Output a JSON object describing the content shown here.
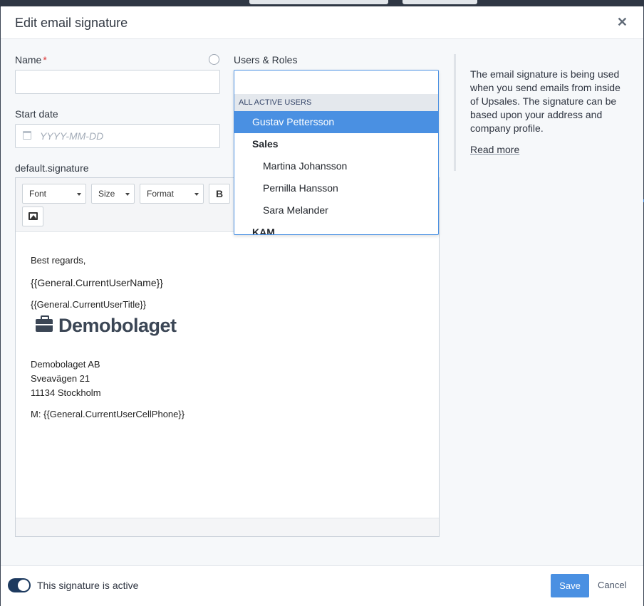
{
  "modal": {
    "title": "Edit email signature",
    "close_icon": "close-icon"
  },
  "form": {
    "name_label": "Name",
    "name_required_marker": "*",
    "name_value": "",
    "start_date_label": "Start date",
    "start_date_placeholder": "YYYY-MM-DD",
    "signature_label": "default.signature",
    "users_roles_label": "Users & Roles"
  },
  "toolbar": {
    "font_label": "Font",
    "size_label": "Size",
    "format_label": "Format",
    "bold_label": "B",
    "image_icon": "image-icon"
  },
  "signature_content": {
    "greeting": "Best regards,",
    "user_name": "{{General.CurrentUserName}}",
    "user_title": "{{General.CurrentUserTitle}}",
    "logo_text": "Demobolaget",
    "company": "Demobolaget AB",
    "street": "Sveavägen 21",
    "city": "11134 Stockholm",
    "mobile": "M: {{General.CurrentUserCellPhone}}"
  },
  "dropdown": {
    "group_header": "ALL ACTIVE USERS",
    "items": [
      {
        "label": "Gustav Pettersson",
        "selected": true,
        "type": "user"
      },
      {
        "label": "Sales",
        "type": "role"
      },
      {
        "label": "Martina Johansson",
        "type": "user"
      },
      {
        "label": "Pernilla Hansson",
        "type": "user"
      },
      {
        "label": "Sara Melander",
        "type": "user"
      },
      {
        "label": "KAM",
        "type": "role"
      }
    ]
  },
  "sidebar": {
    "info_text": "The email signature is being used when you send emails from inside of Upsales. The signature can be based upon your address and company profile.",
    "read_more": "Read more"
  },
  "footer": {
    "active_toggle_label": "This signature is active",
    "active": true,
    "save_label": "Save",
    "cancel_label": "Cancel"
  },
  "colors": {
    "accent": "#4a90e2",
    "toggle_on": "#1d3a5f",
    "required": "#dd3333"
  }
}
